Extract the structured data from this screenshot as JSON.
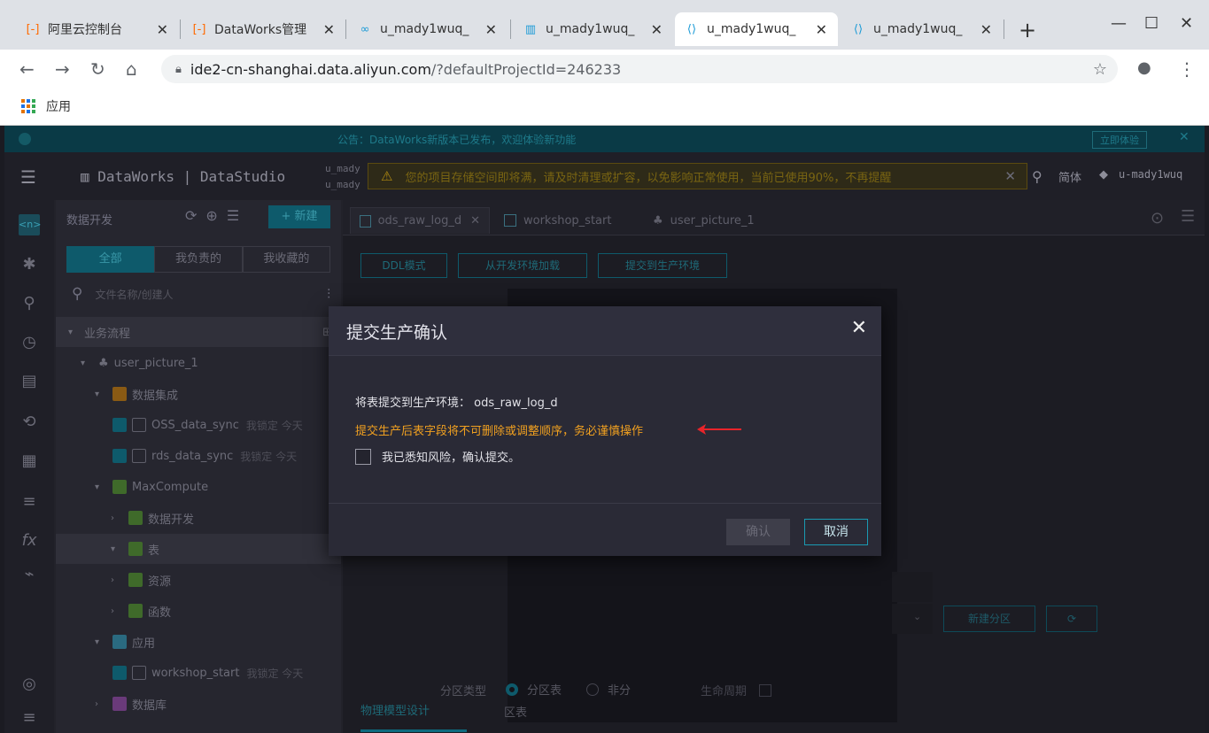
{
  "browser": {
    "tabs": [
      {
        "label": "阿里云控制台",
        "icon": "aliyun-icon",
        "icon_color": "#ff6a00"
      },
      {
        "label": "DataWorks管理",
        "icon": "aliyun-icon",
        "icon_color": "#ff6a00"
      },
      {
        "label": "u_mady1wuq_",
        "icon": "link-icon",
        "icon_color": "#1a9ad6"
      },
      {
        "label": "u_mady1wuq_",
        "icon": "dataworks-icon",
        "icon_color": "#1a9ad6"
      },
      {
        "label": "u_mady1wuq_",
        "icon": "dataworks-ide-icon",
        "icon_color": "#1a9ad6"
      },
      {
        "label": "u_mady1wuq_",
        "icon": "dataworks-ide-icon",
        "icon_color": "#1a9ad6"
      }
    ],
    "url_host": "ide2-cn-shanghai.data.aliyun.com",
    "url_path": "/?defaultProjectId=246233",
    "bookmark_apps": "应用"
  },
  "app": {
    "brand": "DataWorks | DataStudio",
    "project_line1": "u_mady",
    "project_line2": "u_mady",
    "warning": "您的项目存储空间即将满，请及时清理或扩容，以免影响正常使用，当前已使用90%，不再提醒",
    "lang": "简体",
    "user": "u-mady1wuq",
    "banner_text": "公告：DataWorks新版本已发布，欢迎体验新功能",
    "banner_btn": "立即体验"
  },
  "sidebar": {
    "title": "数据开发",
    "new_button": "+ 新建",
    "tabs": [
      "全部",
      "我负责的",
      "我收藏的"
    ],
    "search_placeholder": "文件名称/创建人",
    "tree": [
      {
        "label": "业务流程",
        "meta": ""
      },
      {
        "label": "user_picture_1",
        "meta": ""
      },
      {
        "label": "数据集成",
        "meta": ""
      },
      {
        "label": "OSS_data_sync",
        "meta": "我锁定 今天"
      },
      {
        "label": "rds_data_sync",
        "meta": "我锁定 今天"
      },
      {
        "label": "MaxCompute",
        "meta": ""
      },
      {
        "label": "数据开发",
        "meta": ""
      },
      {
        "label": "表",
        "meta": ""
      },
      {
        "label": "资源",
        "meta": ""
      },
      {
        "label": "函数",
        "meta": ""
      },
      {
        "label": "应用",
        "meta": ""
      },
      {
        "label": "workshop_start",
        "meta": "我锁定 今天"
      },
      {
        "label": "数据库",
        "meta": ""
      }
    ]
  },
  "editor": {
    "tabs": [
      "ods_raw_log_d",
      "workshop_start",
      "user_picture_1"
    ],
    "buttons": [
      "DDL模式",
      "从开发环境加载",
      "提交到生产环境"
    ],
    "refresh_button": "新建分区",
    "bottom_tab": "物理模型设计",
    "partition_label": "分区类型",
    "partition_opt1": "分区表",
    "partition_opt2": "非分",
    "partition_opt3": "区表",
    "lifecycle_label": "生命周期"
  },
  "modal": {
    "title": "提交生产确认",
    "line1": "将表提交到生产环境： ods_raw_log_d",
    "warning": "提交生产后表字段将不可删除或调整顺序，务必谨慎操作",
    "checkbox_label": "我已悉知风险，确认提交。",
    "ok": "确认",
    "cancel": "取消"
  }
}
